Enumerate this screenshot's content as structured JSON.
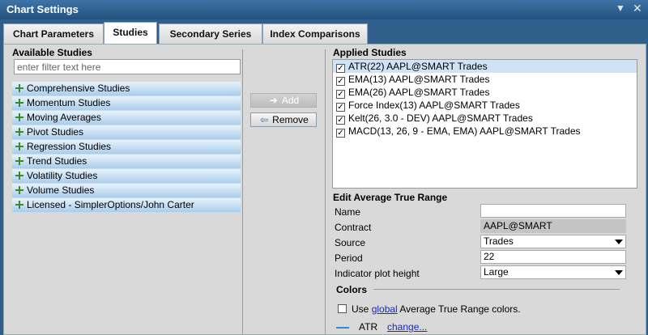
{
  "window": {
    "title": "Chart Settings",
    "icons": [
      "chevron-down-icon",
      "close-icon"
    ]
  },
  "tabs": [
    {
      "label": "Chart Parameters",
      "active": false
    },
    {
      "label": "Studies",
      "active": true
    },
    {
      "label": "Secondary Series",
      "active": false
    },
    {
      "label": "Index Comparisons",
      "active": false
    }
  ],
  "available": {
    "title": "Available Studies",
    "filter_placeholder": "enter filter text here",
    "items": [
      "Comprehensive Studies",
      "Momentum Studies",
      "Moving Averages",
      "Pivot Studies",
      "Regression Studies",
      "Trend Studies",
      "Volatility Studies",
      "Volume Studies",
      "Licensed - SimplerOptions/John Carter"
    ]
  },
  "actions": {
    "add_label": "Add",
    "add_enabled": false,
    "remove_label": "Remove"
  },
  "applied": {
    "title": "Applied Studies",
    "items": [
      {
        "label": "ATR(22) AAPL@SMART Trades",
        "checked": true,
        "selected": true
      },
      {
        "label": "EMA(13) AAPL@SMART Trades",
        "checked": true,
        "selected": false
      },
      {
        "label": "EMA(26) AAPL@SMART Trades",
        "checked": true,
        "selected": false
      },
      {
        "label": "Force Index(13) AAPL@SMART Trades",
        "checked": true,
        "selected": false
      },
      {
        "label": "Kelt(26, 3.0 - DEV) AAPL@SMART Trades",
        "checked": true,
        "selected": false
      },
      {
        "label": "MACD(13, 26, 9 - EMA, EMA) AAPL@SMART Trades",
        "checked": true,
        "selected": false
      }
    ]
  },
  "edit": {
    "title": "Edit Average True Range",
    "name_label": "Name",
    "name_value": "",
    "contract_label": "Contract",
    "contract_value": "AAPL@SMART",
    "source_label": "Source",
    "source_value": "Trades",
    "period_label": "Period",
    "period_value": "22",
    "height_label": "Indicator plot height",
    "height_value": "Large"
  },
  "colors": {
    "title": "Colors",
    "use_prefix": "Use ",
    "use_link": "global",
    "use_suffix": " Average True Range colors.",
    "use_checked": false,
    "series_name": "ATR",
    "series_color": "#2d8ad8",
    "change_link": "change..."
  }
}
